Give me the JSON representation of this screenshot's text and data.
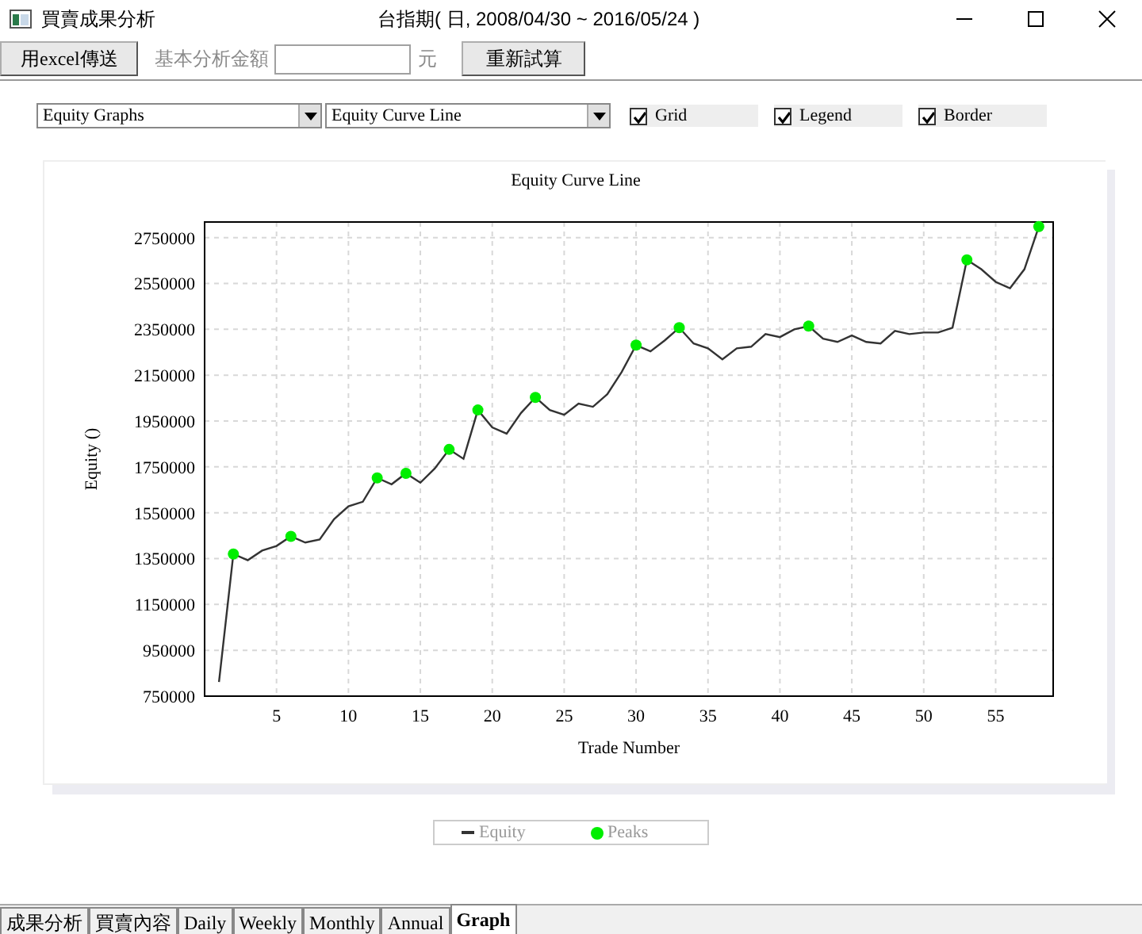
{
  "window": {
    "title": "買賣成果分析",
    "subtitle": "台指期( 日, 2008/04/30 ~ 2016/05/24 )"
  },
  "toolbar": {
    "export_button": "用excel傳送",
    "amount_label": "基本分析金額",
    "unit": "元",
    "recalc_button": "重新試算"
  },
  "options": {
    "dropdowns": [
      {
        "value": "Equity Graphs"
      },
      {
        "value": "Equity Curve Line"
      }
    ],
    "checkboxes": [
      {
        "label": "Grid",
        "checked": true
      },
      {
        "label": "Legend",
        "checked": true
      },
      {
        "label": "Border",
        "checked": true
      }
    ]
  },
  "chart": {
    "chart_data": {
      "type": "line",
      "title": "Equity Curve Line",
      "xlabel": "Trade Number",
      "ylabel": "Equity ()",
      "x": [
        1,
        2,
        3,
        4,
        5,
        6,
        7,
        8,
        9,
        10,
        11,
        12,
        13,
        14,
        15,
        16,
        17,
        18,
        19,
        20,
        21,
        22,
        23,
        24,
        25,
        26,
        27,
        28,
        29,
        30,
        31,
        32,
        33,
        34,
        35,
        36,
        37,
        38,
        39,
        40,
        41,
        42,
        43,
        44,
        45,
        46,
        47,
        48,
        49,
        50,
        51,
        52,
        53,
        54,
        55,
        56,
        57,
        58
      ],
      "series": [
        {
          "name": "Equity",
          "color": "#333333",
          "values": [
            812000,
            1370000,
            1343000,
            1385000,
            1405000,
            1447000,
            1420000,
            1433000,
            1522000,
            1578000,
            1598000,
            1702000,
            1674000,
            1722000,
            1681000,
            1743000,
            1826000,
            1785000,
            1998000,
            1922000,
            1895000,
            1985000,
            2053000,
            1998000,
            1977000,
            2026000,
            2012000,
            2067000,
            2164000,
            2281000,
            2254000,
            2302000,
            2357000,
            2288000,
            2267000,
            2219000,
            2267000,
            2274000,
            2329000,
            2316000,
            2350000,
            2364000,
            2309000,
            2295000,
            2323000,
            2295000,
            2288000,
            2343000,
            2329000,
            2336000,
            2336000,
            2357000,
            2653000,
            2612000,
            2557000,
            2529000,
            2612000,
            2798000
          ]
        },
        {
          "name": "Peaks",
          "color": "#00ee00",
          "type": "scatter",
          "values": [
            null,
            1370000,
            null,
            null,
            null,
            1447000,
            null,
            null,
            null,
            null,
            null,
            1702000,
            null,
            1722000,
            null,
            null,
            1826000,
            null,
            1998000,
            null,
            null,
            null,
            2053000,
            null,
            null,
            null,
            null,
            null,
            null,
            2281000,
            null,
            null,
            2357000,
            null,
            null,
            null,
            null,
            null,
            null,
            null,
            null,
            2364000,
            null,
            null,
            null,
            null,
            null,
            null,
            null,
            null,
            null,
            null,
            2653000,
            null,
            null,
            null,
            null,
            2798000
          ]
        }
      ],
      "grid": true,
      "xlim": [
        0,
        59
      ],
      "ylim": [
        750000,
        2818000
      ],
      "xticks": [
        5,
        10,
        15,
        20,
        25,
        30,
        35,
        40,
        45,
        50,
        55
      ],
      "yticks": [
        750000,
        950000,
        1150000,
        1350000,
        1550000,
        1750000,
        1950000,
        2150000,
        2350000,
        2550000,
        2750000
      ]
    }
  },
  "tabs": [
    {
      "label": "成果分析",
      "selected": false
    },
    {
      "label": "買賣內容",
      "selected": false
    },
    {
      "label": "Daily",
      "selected": false
    },
    {
      "label": "Weekly",
      "selected": false
    },
    {
      "label": "Monthly",
      "selected": false
    },
    {
      "label": "Annual",
      "selected": false
    },
    {
      "label": "Graph",
      "selected": true
    }
  ]
}
